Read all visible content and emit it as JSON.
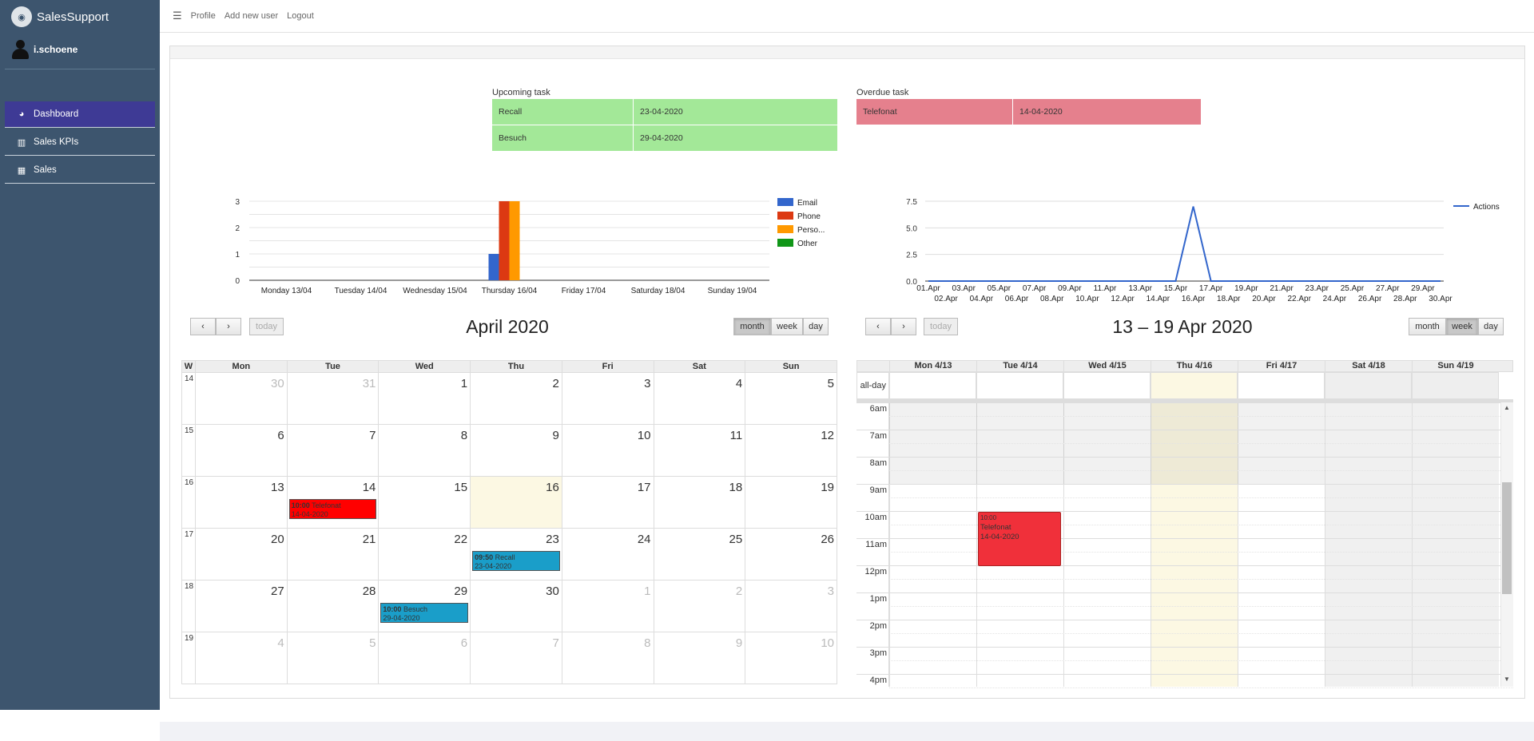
{
  "app": {
    "brand": "SalesSupport",
    "user": "i.schoene"
  },
  "sidebar": {
    "items": [
      {
        "label": "Dashboard",
        "icon": "dashboard-icon"
      },
      {
        "label": "Sales KPIs",
        "icon": "bar-chart-icon"
      },
      {
        "label": "Sales",
        "icon": "grid-icon"
      }
    ]
  },
  "topbar": {
    "profile": "Profile",
    "add_user": "Add new user",
    "logout": "Logout"
  },
  "upcoming": {
    "title": "Upcoming task",
    "rows": [
      {
        "name": "Recall",
        "date": "23-04-2020"
      },
      {
        "name": "Besuch",
        "date": "29-04-2020"
      }
    ]
  },
  "overdue": {
    "title": "Overdue task",
    "rows": [
      {
        "name": "Telefonat",
        "date": "14-04-2020"
      }
    ]
  },
  "colors": {
    "email": "#3366cc",
    "phone": "#dc3912",
    "personal": "#ff9900",
    "other": "#109618",
    "line": "#3366cc",
    "upcoming": "#a3e898",
    "overdue": "#e5808d",
    "event_blue": "#1a9ec9",
    "event_red": "#f00"
  },
  "chart_data": [
    {
      "type": "bar",
      "categories": [
        "Monday 13/04",
        "Tuesday 14/04",
        "Wednesday 15/04",
        "Thursday 16/04",
        "Friday 17/04",
        "Saturday 18/04",
        "Sunday 19/04"
      ],
      "series": [
        {
          "name": "Email",
          "values": [
            0,
            0,
            0,
            1,
            0,
            0,
            0
          ]
        },
        {
          "name": "Phone",
          "values": [
            0,
            0,
            0,
            3,
            0,
            0,
            0
          ]
        },
        {
          "name": "Perso...",
          "values": [
            0,
            0,
            0,
            3,
            0,
            0,
            0
          ]
        },
        {
          "name": "Other",
          "values": [
            0,
            0,
            0,
            0,
            0,
            0,
            0
          ]
        }
      ],
      "ylim": [
        0,
        3
      ],
      "yticks": [
        0,
        1,
        2,
        3
      ],
      "legend": "right",
      "grid": true
    },
    {
      "type": "line",
      "x": [
        "01.Apr",
        "02.Apr",
        "03.Apr",
        "04.Apr",
        "05.Apr",
        "06.Apr",
        "07.Apr",
        "08.Apr",
        "09.Apr",
        "10.Apr",
        "11.Apr",
        "12.Apr",
        "13.Apr",
        "14.Apr",
        "15.Apr",
        "16.Apr",
        "17.Apr",
        "18.Apr",
        "19.Apr",
        "20.Apr",
        "21.Apr",
        "22.Apr",
        "23.Apr",
        "24.Apr",
        "25.Apr",
        "26.Apr",
        "27.Apr",
        "28.Apr",
        "29.Apr",
        "30.Apr"
      ],
      "series": [
        {
          "name": "Actions",
          "values": [
            0,
            0,
            0,
            0,
            0,
            0,
            0,
            0,
            0,
            0,
            0,
            0,
            0,
            0,
            0,
            7,
            0,
            0,
            0,
            0,
            0,
            0,
            0,
            0,
            0,
            0,
            0,
            0,
            0,
            0
          ]
        }
      ],
      "ylim": [
        0,
        7.5
      ],
      "yticks": [
        "0.0",
        "2.5",
        "5.0",
        "7.5"
      ],
      "legend": "right",
      "grid": true
    }
  ],
  "month_cal": {
    "title": "April 2020",
    "buttons": {
      "prev": "‹",
      "next": "›",
      "today": "today",
      "month": "month",
      "week": "week",
      "day": "day"
    },
    "headers": [
      "W",
      "Mon",
      "Tue",
      "Wed",
      "Thu",
      "Fri",
      "Sat",
      "Sun"
    ],
    "weeks": [
      {
        "wk": "14",
        "days": [
          "30",
          "31",
          "1",
          "2",
          "3",
          "4",
          "5"
        ]
      },
      {
        "wk": "15",
        "days": [
          "6",
          "7",
          "8",
          "9",
          "10",
          "11",
          "12"
        ]
      },
      {
        "wk": "16",
        "days": [
          "13",
          "14",
          "15",
          "16",
          "17",
          "18",
          "19"
        ]
      },
      {
        "wk": "17",
        "days": [
          "20",
          "21",
          "22",
          "23",
          "24",
          "25",
          "26"
        ]
      },
      {
        "wk": "18",
        "days": [
          "27",
          "28",
          "29",
          "30",
          "1",
          "2",
          "3"
        ]
      },
      {
        "wk": "19",
        "days": [
          "4",
          "5",
          "6",
          "7",
          "8",
          "9",
          "10"
        ]
      }
    ],
    "events": [
      {
        "time": "10:00",
        "title": "Telefonat",
        "date": "14-04-2020"
      },
      {
        "time": "09:50",
        "title": "Recall",
        "date": "23-04-2020"
      },
      {
        "time": "10:00",
        "title": "Besuch",
        "date": "29-04-2020"
      }
    ]
  },
  "week_cal": {
    "title": "13 – 19 Apr 2020",
    "buttons": {
      "prev": "‹",
      "next": "›",
      "today": "today",
      "month": "month",
      "week": "week",
      "day": "day"
    },
    "headers": [
      "Mon 4/13",
      "Tue 4/14",
      "Wed 4/15",
      "Thu 4/16",
      "Fri 4/17",
      "Sat 4/18",
      "Sun 4/19"
    ],
    "allday": "all-day",
    "times": [
      "6am",
      "7am",
      "8am",
      "9am",
      "10am",
      "11am",
      "12pm",
      "1pm",
      "2pm",
      "3pm",
      "4pm"
    ],
    "event": {
      "time": "10:00",
      "title": "Telefonat",
      "date": "14-04-2020"
    }
  }
}
